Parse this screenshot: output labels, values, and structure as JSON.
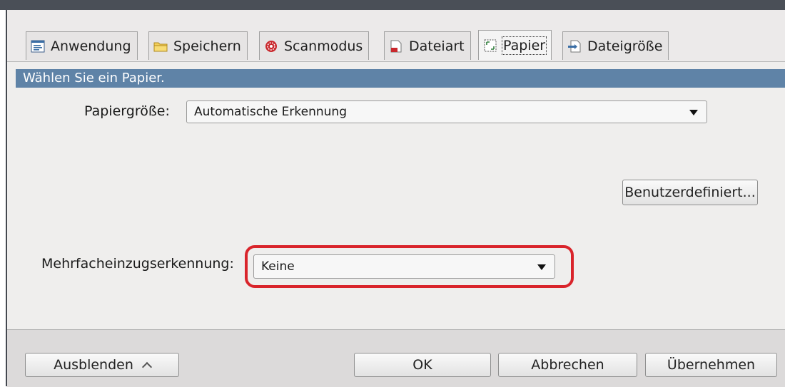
{
  "tabs": [
    {
      "label": "Anwendung",
      "icon": "application-icon"
    },
    {
      "label": "Speichern",
      "icon": "folder-icon"
    },
    {
      "label": "Scanmodus",
      "icon": "scan-mode-icon"
    },
    {
      "label": "Dateiart",
      "icon": "file-type-icon"
    },
    {
      "label": "Papier",
      "icon": "paper-icon"
    },
    {
      "label": "Dateigröße",
      "icon": "file-size-icon"
    }
  ],
  "active_tab": "Papier",
  "header": {
    "text": "Wählen Sie ein Papier."
  },
  "paper_size": {
    "label": "Papiergröße:",
    "value": "Automatische Erkennung"
  },
  "custom_button": {
    "label": "Benutzerdefiniert..."
  },
  "multifeed": {
    "label": "Mehrfacheinzugserkennung:",
    "value": "Keine"
  },
  "footer": {
    "hide_label": "Ausblenden",
    "ok_label": "OK",
    "cancel_label": "Abbrechen",
    "apply_label": "Übernehmen"
  },
  "colors": {
    "header_bar": "#5f83a7",
    "highlight": "#d9242b"
  }
}
